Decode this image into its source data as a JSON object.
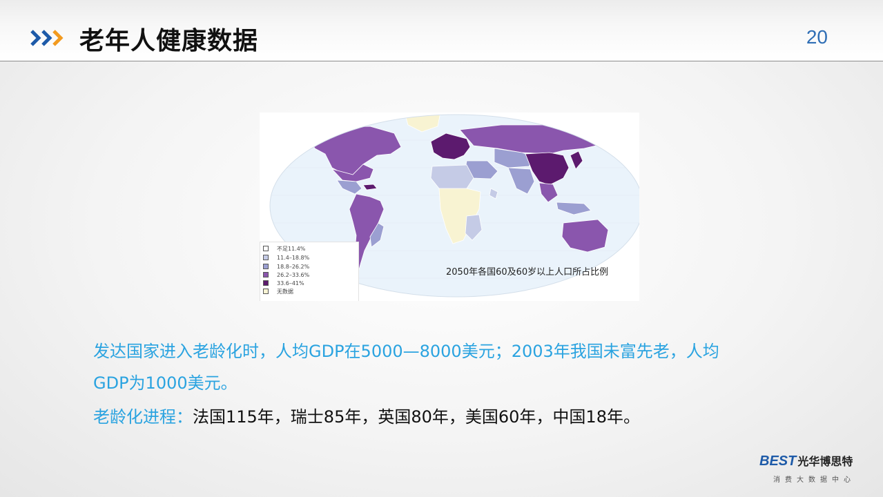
{
  "header": {
    "icon": "triple-chevron-icon",
    "title": "老年人健康数据",
    "page_number": "20"
  },
  "map": {
    "caption": "2050年各国60及60岁以上人口所占比例",
    "legend": [
      {
        "label": "不足11.4%",
        "color": "#ffffff"
      },
      {
        "label": "11.4–18.8%",
        "color": "#c5cbe6"
      },
      {
        "label": "18.8–26.2%",
        "color": "#9b9fd1"
      },
      {
        "label": "26.2–33.6%",
        "color": "#8a56ad"
      },
      {
        "label": "33.6–41%",
        "color": "#5c1a6e"
      },
      {
        "label": "无数据",
        "color": "#f8f3d2"
      }
    ]
  },
  "text": {
    "line1": "发达国家进入老龄化时，人均GDP在5000—8000美元；2003年我国未富先老，人均",
    "line2": "GDP为1000美元。",
    "line3_label": "老龄化进程：",
    "line3_value": "法国115年，瑞士85年，英国80年，美国60年，中国18年。"
  },
  "logo": {
    "brand": "BEST",
    "name": "光华博思特",
    "subtitle": "消费大数据中心"
  },
  "colors": {
    "accent_blue": "#2aa3e0",
    "title_dark": "#111111",
    "page_number": "#2f6eb5",
    "chevron_blue": "#1d5aa8",
    "chevron_orange": "#f29a1f"
  }
}
